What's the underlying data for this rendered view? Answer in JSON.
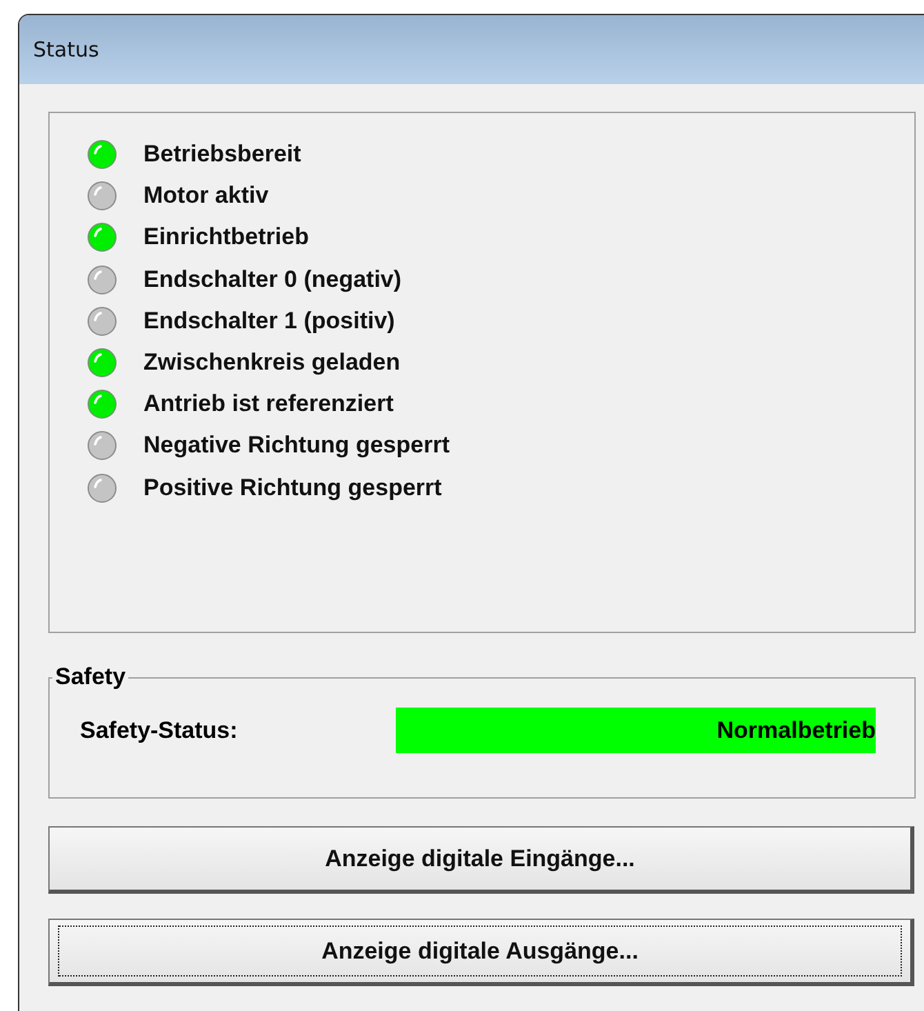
{
  "window": {
    "title": "Status"
  },
  "indicators": [
    {
      "label": "Betriebsbereit",
      "on": true
    },
    {
      "label": "Motor aktiv",
      "on": false
    },
    {
      "label": "Einrichtbetrieb",
      "on": true
    },
    {
      "label": "Endschalter 0 (negativ)",
      "on": false
    },
    {
      "label": "Endschalter 1 (positiv)",
      "on": false
    },
    {
      "label": "Zwischenkreis geladen",
      "on": true
    },
    {
      "label": "Antrieb ist referenziert",
      "on": true
    },
    {
      "label": "Negative Richtung gesperrt",
      "on": false
    },
    {
      "label": "Positive Richtung gesperrt",
      "on": false
    }
  ],
  "safety": {
    "title": "Safety",
    "label": "Safety-Status:",
    "value": "Normalbetrieb",
    "color": "#00ff00"
  },
  "buttons": [
    {
      "label": "Anzeige digitale Eingänge...",
      "focused": false
    },
    {
      "label": "Anzeige digitale Ausgänge...",
      "focused": true
    }
  ]
}
